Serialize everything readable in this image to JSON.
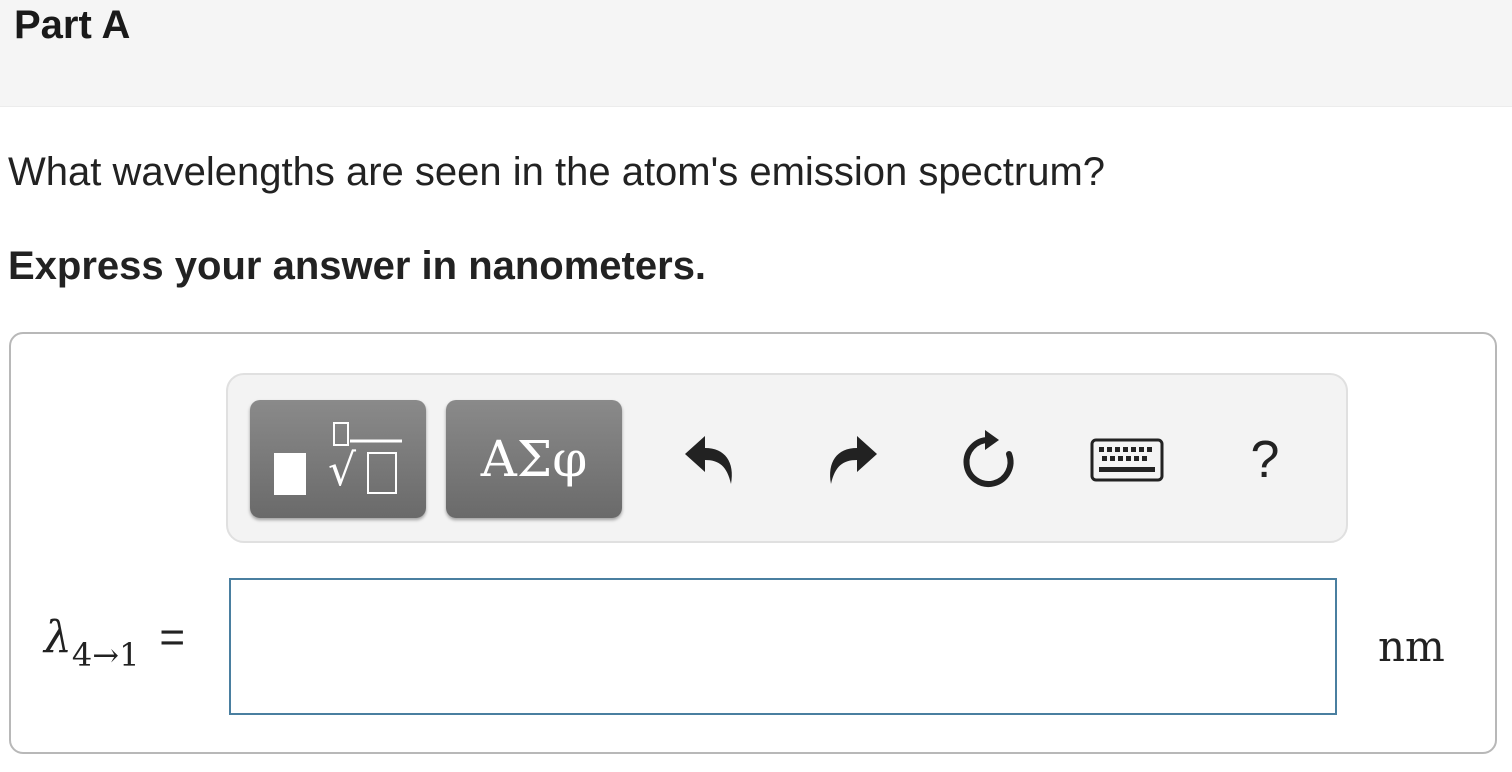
{
  "part": {
    "title": "Part A"
  },
  "question": {
    "text": "What wavelengths are seen in the atom's emission spectrum?"
  },
  "instruction": {
    "text": "Express your answer in nanometers."
  },
  "toolbar": {
    "templates_icon": "templates-root-icon",
    "symbols_label": "ΑΣφ",
    "undo_icon": "undo-icon",
    "redo_icon": "redo-icon",
    "reset_icon": "reset-icon",
    "keyboard_icon": "keyboard-icon",
    "help_label": "?"
  },
  "answer": {
    "variable_symbol": "λ",
    "variable_subscript": "4→1",
    "equals": "=",
    "value": "",
    "unit": "nm"
  }
}
